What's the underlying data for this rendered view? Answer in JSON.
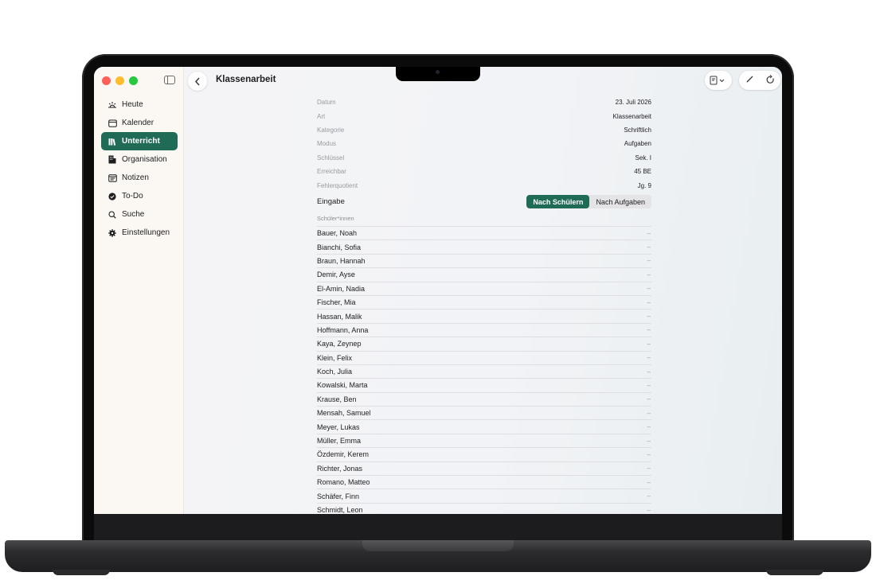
{
  "sidebar": {
    "items": [
      {
        "label": "Heute",
        "icon": "sunrise-icon",
        "active": false
      },
      {
        "label": "Kalender",
        "icon": "calendar-icon",
        "active": false
      },
      {
        "label": "Unterricht",
        "icon": "books-icon",
        "active": true
      },
      {
        "label": "Organisation",
        "icon": "building-icon",
        "active": false
      },
      {
        "label": "Notizen",
        "icon": "notes-icon",
        "active": false
      },
      {
        "label": "To-Do",
        "icon": "checkmark-circle-icon",
        "active": false
      },
      {
        "label": "Suche",
        "icon": "search-icon",
        "active": false
      },
      {
        "label": "Einstellungen",
        "icon": "gear-icon",
        "active": false
      }
    ]
  },
  "toolbar": {
    "title": "Klassenarbeit"
  },
  "details": [
    {
      "key": "Datum",
      "value": "23. Juli 2026"
    },
    {
      "key": "Art",
      "value": "Klassenarbeit"
    },
    {
      "key": "Kategorie",
      "value": "Schriftlich"
    },
    {
      "key": "Modus",
      "value": "Aufgaben"
    },
    {
      "key": "Schlüssel",
      "value": "Sek. I"
    },
    {
      "key": "Erreichbar",
      "value": "45 BE"
    },
    {
      "key": "Fehlerquotient",
      "value": "Jg. 9"
    }
  ],
  "eingabe": {
    "label": "Eingabe",
    "options": [
      "Nach Schülern",
      "Nach Aufgaben"
    ],
    "selected": "Nach Schülern"
  },
  "students_header": "Schüler*innen",
  "students": [
    {
      "name": "Bauer, Noah",
      "value": "–"
    },
    {
      "name": "Bianchi, Sofia",
      "value": "–"
    },
    {
      "name": "Braun, Hannah",
      "value": "–"
    },
    {
      "name": "Demir, Ayse",
      "value": "–"
    },
    {
      "name": "El-Amin, Nadia",
      "value": "–"
    },
    {
      "name": "Fischer, Mia",
      "value": "–"
    },
    {
      "name": "Hassan, Malik",
      "value": "–"
    },
    {
      "name": "Hoffmann, Anna",
      "value": "–"
    },
    {
      "name": "Kaya, Zeynep",
      "value": "–"
    },
    {
      "name": "Klein, Felix",
      "value": "–"
    },
    {
      "name": "Koch, Julia",
      "value": "–"
    },
    {
      "name": "Kowalski, Marta",
      "value": "–"
    },
    {
      "name": "Krause, Ben",
      "value": "–"
    },
    {
      "name": "Mensah, Samuel",
      "value": "–"
    },
    {
      "name": "Meyer, Lukas",
      "value": "–"
    },
    {
      "name": "Müller, Emma",
      "value": "–"
    },
    {
      "name": "Özdemir, Kerem",
      "value": "–"
    },
    {
      "name": "Richter, Jonas",
      "value": "–"
    },
    {
      "name": "Romano, Matteo",
      "value": "–"
    },
    {
      "name": "Schäfer, Finn",
      "value": "–"
    },
    {
      "name": "Schmidt, Leon",
      "value": "–"
    }
  ],
  "colors": {
    "accent": "#1f6b56",
    "sidebar_bg": "#fbf8f3"
  }
}
